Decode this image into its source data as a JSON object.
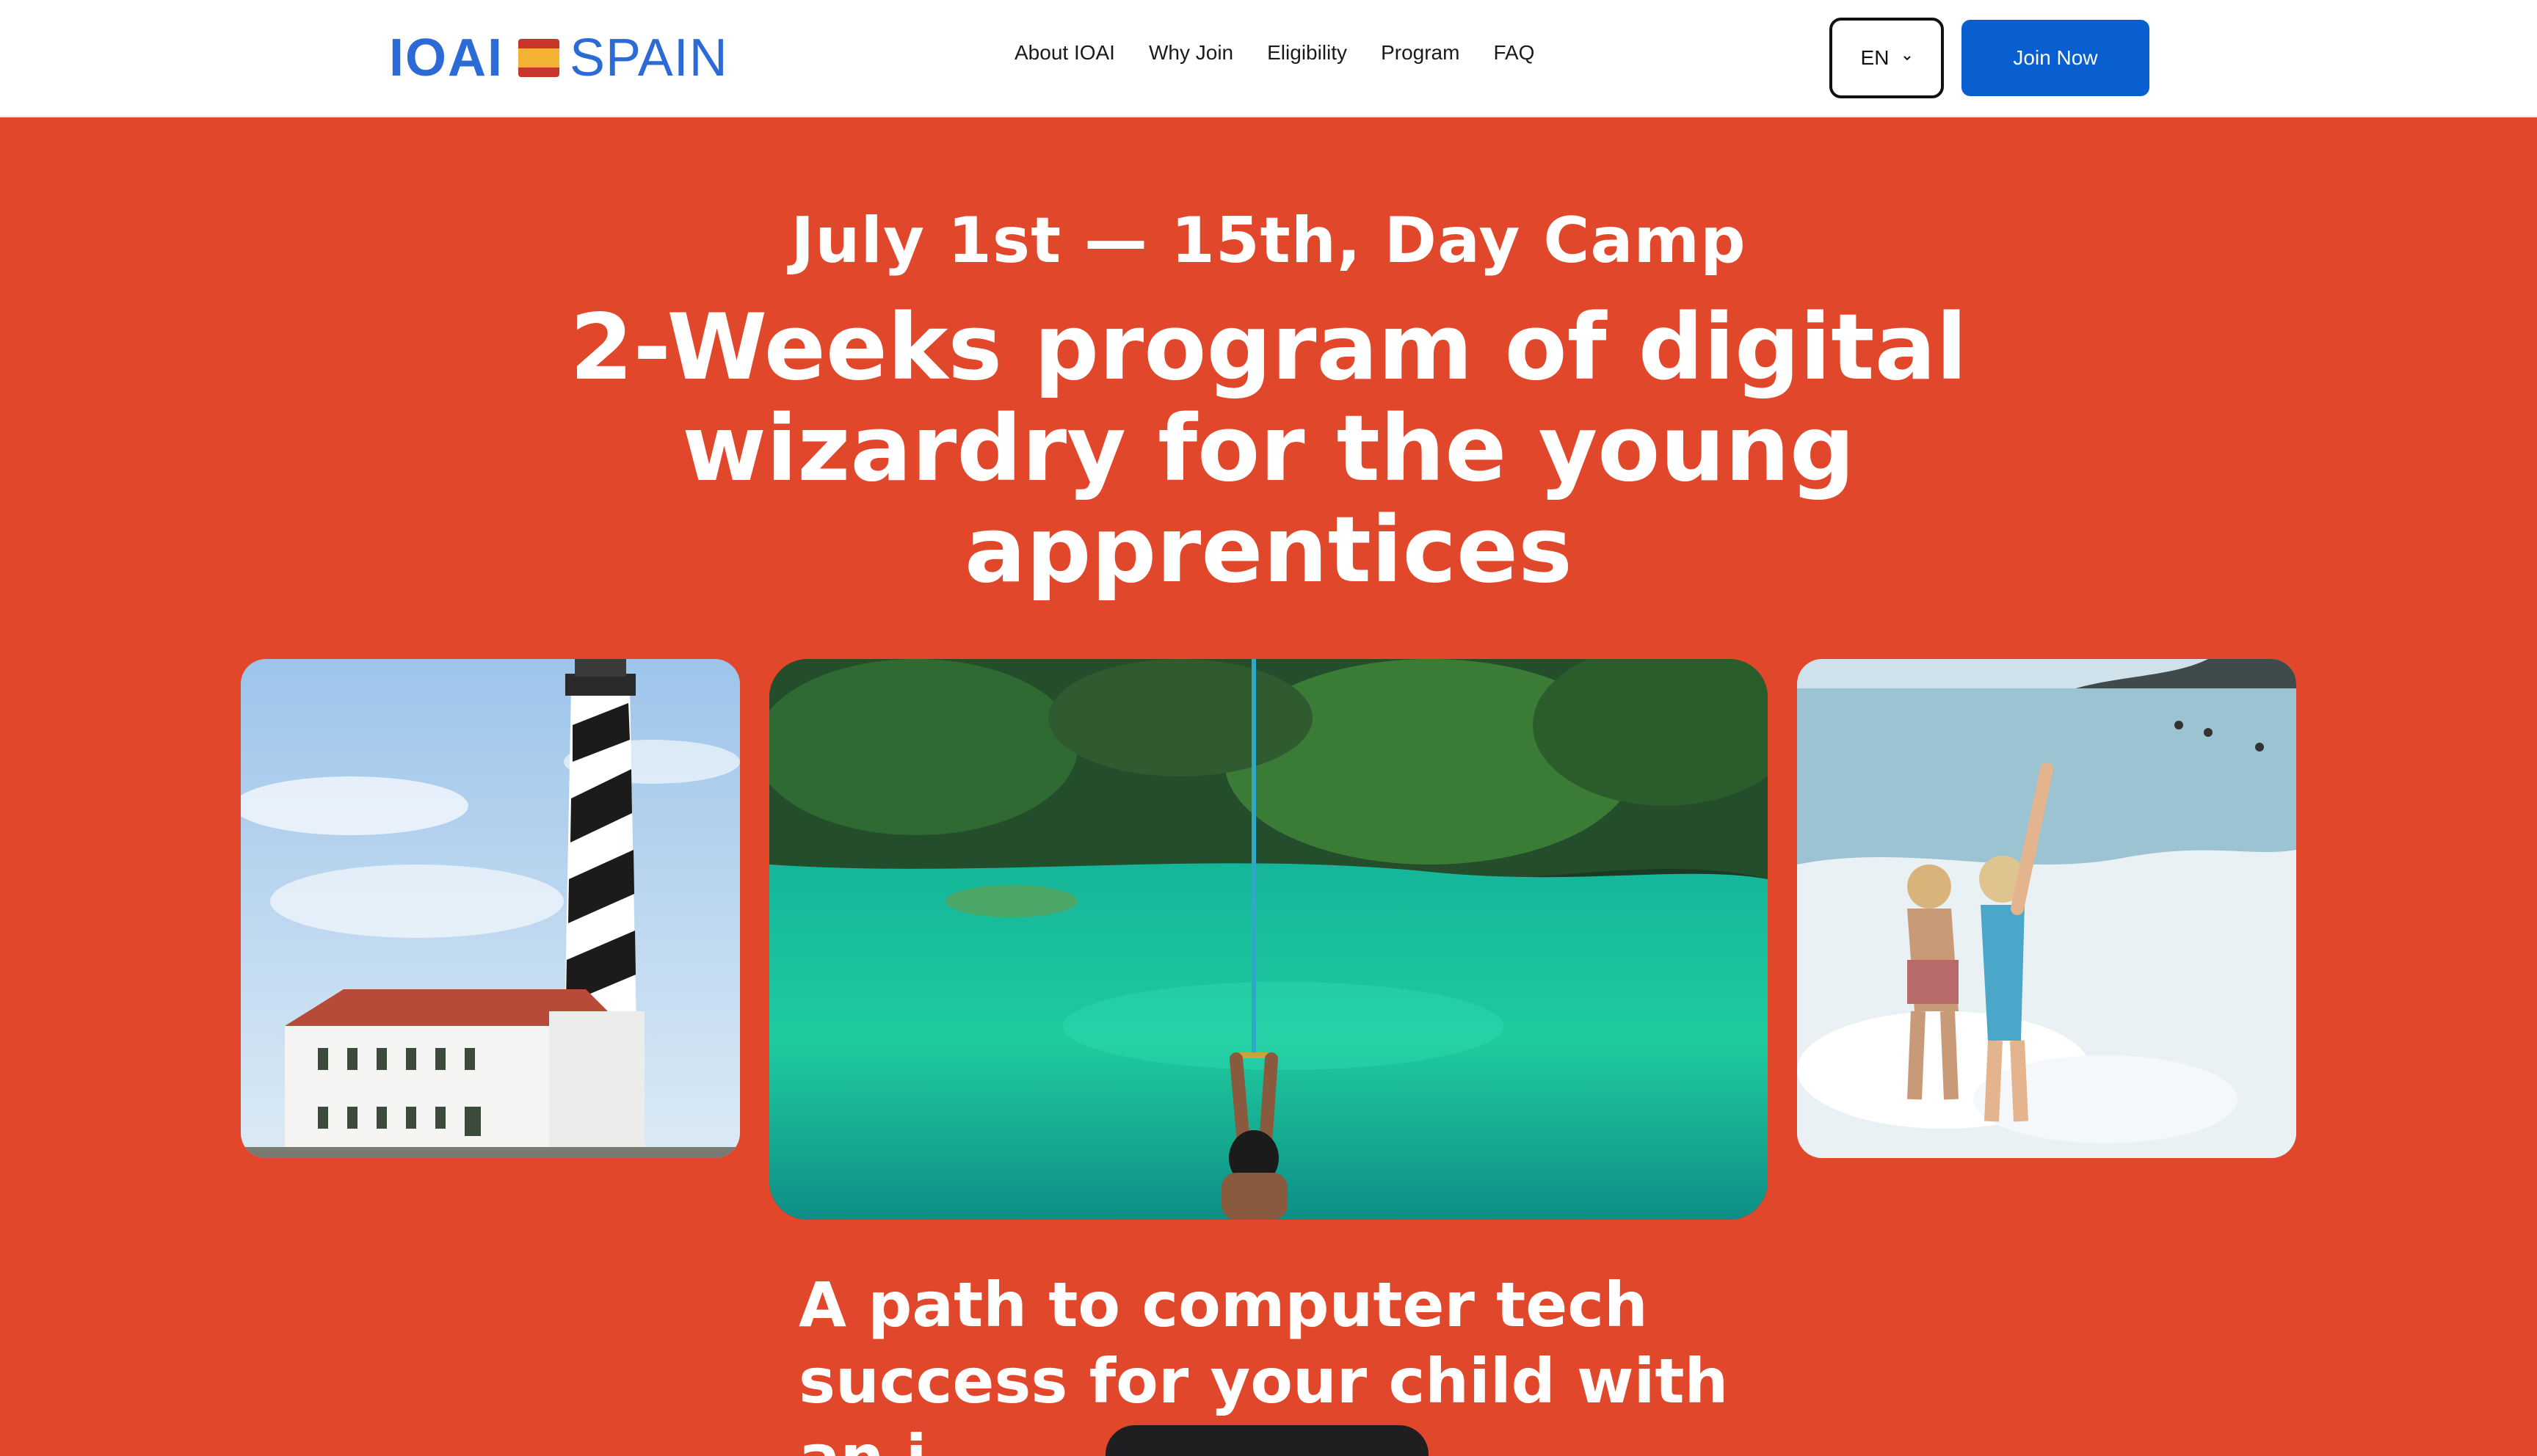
{
  "header": {
    "logo": {
      "brand": "IOAI",
      "country": "SPAIN"
    },
    "nav": [
      "About IOAI",
      "Why Join",
      "Eligibility",
      "Program",
      "FAQ"
    ],
    "language": "EN",
    "cta_label": "Join Now"
  },
  "hero": {
    "eyebrow": "July 1st — 15th, Day Camp",
    "headline": "2-Weeks program of digital wizardry for the young apprentices",
    "subheadline": "A path to computer tech success for your child with an i"
  },
  "colors": {
    "background": "#E1472B",
    "brand_blue": "#2C6BD6",
    "cta_blue": "#0A5FD0"
  },
  "icons": [
    "spain-flag-icon",
    "chevron-down-icon"
  ]
}
